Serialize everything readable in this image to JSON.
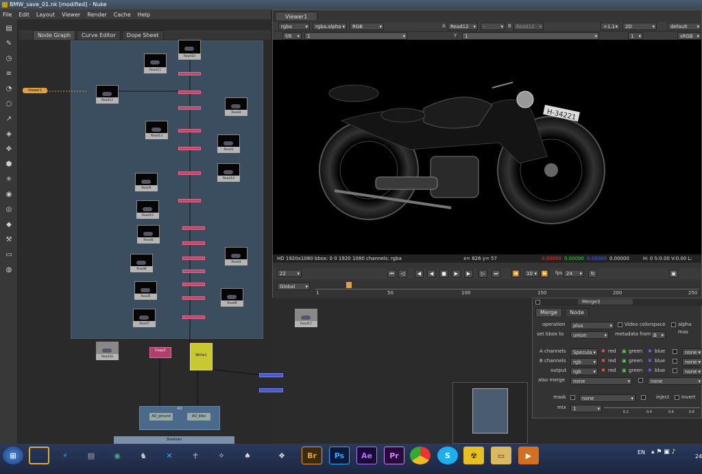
{
  "window": {
    "title": "BMW_save_01.nk [modified] - Nuke"
  },
  "menu": [
    "File",
    "Edit",
    "Layout",
    "Viewer",
    "Render",
    "Cache",
    "Help"
  ],
  "node_graph_tabs": [
    "Node Graph",
    "Curve Editor",
    "Dope Sheet"
  ],
  "node_graph": {
    "viewer_node": "Viewer1",
    "read_labels": [
      "Read10",
      "Read11",
      "Read12",
      "Read2",
      "Read13",
      "Read1",
      "Read14",
      "Read4",
      "Read15",
      "Read6",
      "Read3",
      "Read8",
      "Read5",
      "Read9",
      "Read7",
      "Read16",
      "Read17"
    ],
    "other_nodes": {
      "copy": "Copy1",
      "write": "Write1",
      "dot_group": "AO",
      "ao_ground": "AO_ground",
      "ao_bike": "AO_bike",
      "shadows": "Shadows"
    }
  },
  "viewer": {
    "tab": "Viewer1",
    "channels": "rgba",
    "alpha": "rgba.alpha",
    "colorspace_disp": "RGB",
    "a_label": "A",
    "a_input": "Read12",
    "a_op": "-",
    "b_label": "B",
    "b_input": "Read12",
    "gain": "+1.1",
    "mode": "2D",
    "lut": "default",
    "fstop": "f/8",
    "frame_small": "1",
    "y_label": "Y",
    "y_value": "1",
    "proxy": "1",
    "srgb": "sRGB",
    "info_left": "HD 1920x1080 bbox: 0 0 1920 1080 channels: rgba",
    "info_xy": "x= 826 y=  57",
    "info_r": "0.00000",
    "info_g": "0.00000",
    "info_b": "0.00000",
    "info_a": "0.00000",
    "info_hsv": "H:  0 S:0.00 V:0.00  L:",
    "plate": "H-34221"
  },
  "transport": {
    "frame": "22",
    "step": "10",
    "fps_label": "fps",
    "fps": "24",
    "scope": "Global"
  },
  "timeline": {
    "ticks": [
      "1",
      "50",
      "100",
      "150",
      "200",
      "250"
    ]
  },
  "properties": {
    "node": "Merge3",
    "tabs": [
      "Merge",
      "Node"
    ],
    "operation_label": "operation",
    "operation": "plus",
    "video_colorspace": "Video colorspace",
    "alpha_masking": "alpha mas",
    "bbox_label": "set bbox to",
    "bbox": "union",
    "metadata_label": "metadata from",
    "metadata": "B",
    "a_channels_label": "A channels",
    "a_channels": "Specula",
    "b_channels_label": "B channels",
    "b_channels": "rgb",
    "output_label": "output",
    "output": "rgb",
    "red": "red",
    "green": "green",
    "blue": "blue",
    "none": "none",
    "also_merge_label": "also merge",
    "also_merge": "none",
    "also_merge2": "none",
    "mask_label": "mask",
    "mask": "none",
    "inject": "inject",
    "invert": "invert",
    "mix_label": "mix",
    "mix": "1",
    "mix_ticks": [
      "0.2",
      "0.4",
      "0.6",
      "0.8"
    ]
  },
  "taskbar": {
    "lang": "EN",
    "apps": [
      "Br",
      "Ps",
      "Ae",
      "Pr"
    ],
    "clock": "24"
  }
}
